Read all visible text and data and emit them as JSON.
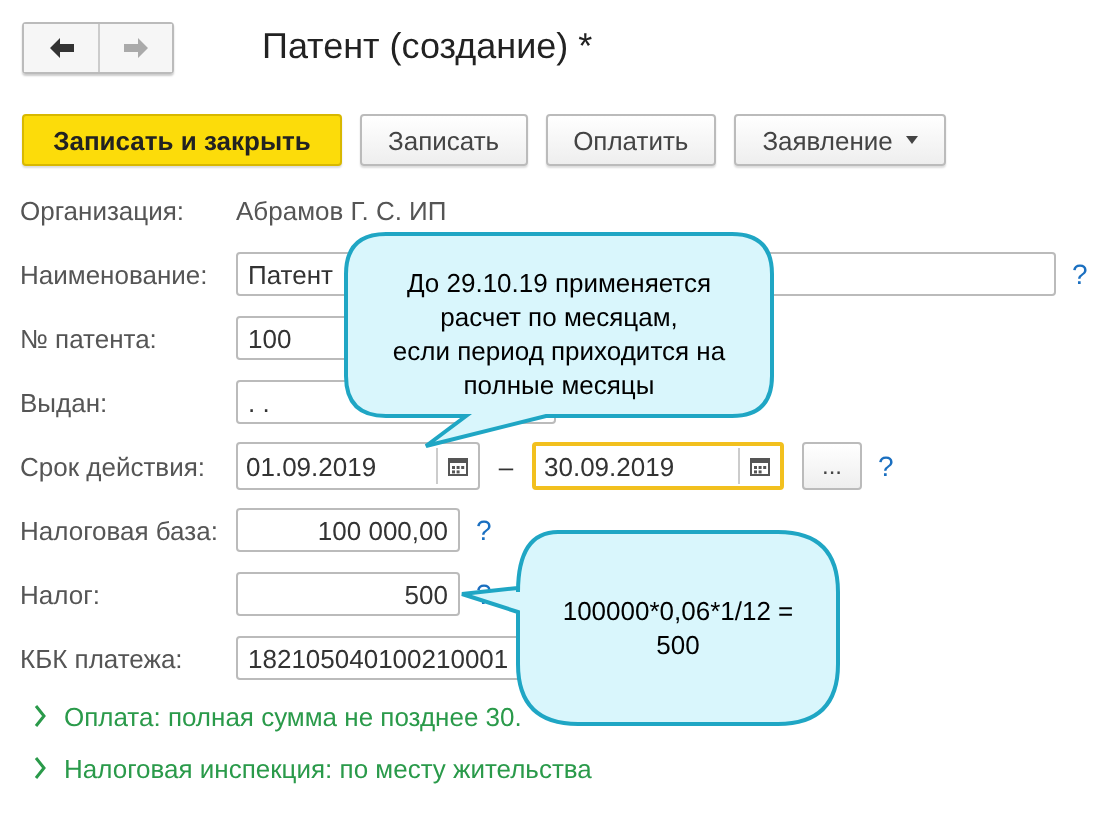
{
  "window": {
    "title": "Патент (создание) *"
  },
  "nav": [
    {
      "kind": "back",
      "disabled": false
    },
    {
      "kind": "forward",
      "disabled": true
    }
  ],
  "buttons": [
    {
      "label": "Записать и закрыть",
      "kind": "primary",
      "dropdown": false
    },
    {
      "label": "Записать",
      "kind": "normal",
      "dropdown": false
    },
    {
      "label": "Оплатить",
      "kind": "normal",
      "dropdown": false
    },
    {
      "label": "Заявление",
      "kind": "normal",
      "dropdown": true
    }
  ],
  "fields": [
    {
      "kind": "text",
      "label": "Организация:",
      "value": "Абрамов Г. С. ИП"
    },
    {
      "kind": "input",
      "label": "Наименование:",
      "value": "Патент",
      "help": "?"
    },
    {
      "kind": "input",
      "label": "№ патента:",
      "value": "100"
    },
    {
      "kind": "input",
      "label": "Выдан:",
      "value": ". ."
    },
    {
      "kind": "period",
      "label": "Срок действия:",
      "from": "01.09.2019",
      "separator": "–",
      "to": "30.09.2019",
      "to_focused": true,
      "more": "...",
      "help": "?"
    },
    {
      "kind": "input",
      "label": "Налоговая база:",
      "value": "100 000,00",
      "help": "?"
    },
    {
      "kind": "input",
      "label": "Налог:",
      "value": "500",
      "help": "?"
    },
    {
      "kind": "input",
      "label": "КБК платежа:",
      "value": "182105040100210001"
    }
  ],
  "sections": [
    {
      "label": "Оплата: полная сумма не позднее 30.",
      "expanded": false
    },
    {
      "label": "Налоговая инспекция: по месту жительства",
      "expanded": false
    }
  ],
  "callouts": [
    {
      "text": "До 29.10.19 применяется\nрасчет по месяцам,\nесли период приходится на\nполные месяцы"
    },
    {
      "text": "100000*0,06*1/12 =\n500"
    }
  ]
}
